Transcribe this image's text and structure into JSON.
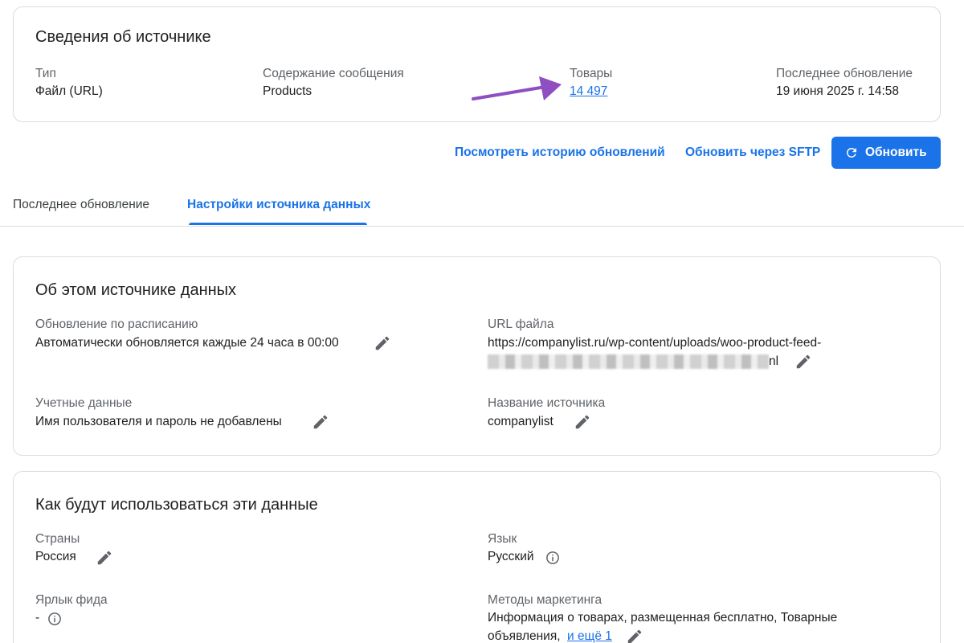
{
  "source_info": {
    "title": "Сведения об источнике",
    "type_label": "Тип",
    "type_value": "Файл (URL)",
    "content_label": "Содержание сообщения",
    "content_value": "Products",
    "products_label": "Товары",
    "products_value": "14 497",
    "updated_label": "Последнее обновление",
    "updated_value": "19 июня 2025 г. 14:58"
  },
  "actions": {
    "history": "Посмотреть историю обновлений",
    "sftp": "Обновить через SFTP",
    "refresh": "Обновить",
    "refresh_color": "#1a73e8"
  },
  "tabs": [
    {
      "label": "Последнее обновление",
      "active": false
    },
    {
      "label": "Настройки источника данных",
      "active": true
    }
  ],
  "about": {
    "title": "Об этом источнике данных",
    "schedule_label": "Обновление по расписанию",
    "schedule_value": "Автоматически обновляется каждые 24 часа в 00:00",
    "url_label": "URL файла",
    "url_value_line1": "https://companylist.ru/wp-content/uploads/woo-product-feed-",
    "url_value_tail": "nl",
    "credentials_label": "Учетные данные",
    "credentials_value": "Имя пользователя и пароль не добавлены",
    "name_label": "Название источника",
    "name_value": "companylist"
  },
  "usage": {
    "title": "Как будут использоваться эти данные",
    "countries_label": "Страны",
    "countries_value": "Россия",
    "language_label": "Язык",
    "language_value": "Русский",
    "feed_label_label": "Ярлык фида",
    "feed_label_value": "-",
    "marketing_label": "Методы маркетинга",
    "marketing_value_line1": "Информация о товарах, размещенная бесплатно, Товарные",
    "marketing_value_line2": "объявления,",
    "marketing_more": "и ещё 1"
  },
  "icons": {
    "edit": "pencil-icon",
    "info": "info-icon",
    "refresh": "refresh-icon",
    "arrow": "arrow-annotation"
  },
  "colors": {
    "accent": "#1a73e8",
    "arrow": "#8e4fc1"
  }
}
